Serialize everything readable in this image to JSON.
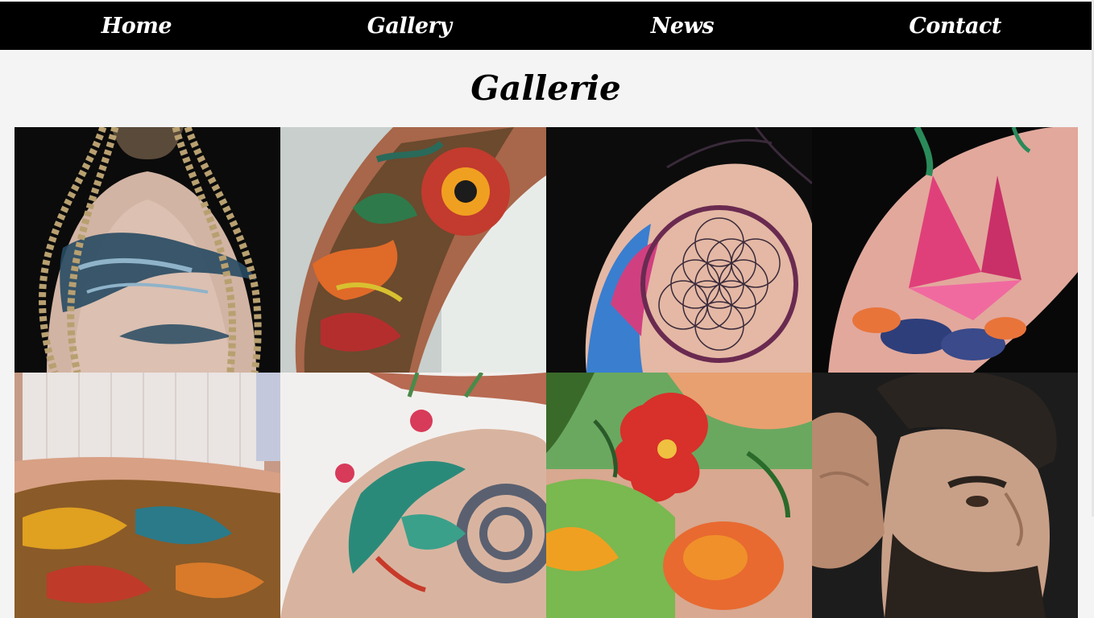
{
  "nav": {
    "items": [
      {
        "label": "Home"
      },
      {
        "label": "Gallery"
      },
      {
        "label": "News"
      },
      {
        "label": "Contact"
      }
    ]
  },
  "page": {
    "title": "Gallerie"
  },
  "colors": {
    "nav_bg": "#000000",
    "nav_text": "#ffffff",
    "page_bg": "#f4f4f4",
    "title": "#000000"
  },
  "gallery": {
    "images": [
      {
        "icon": "tattoo-photo-back-tribal"
      },
      {
        "icon": "tattoo-photo-arm-dragon"
      },
      {
        "icon": "tattoo-photo-shoulder-geometric"
      },
      {
        "icon": "tattoo-photo-arm-origami-crane"
      },
      {
        "icon": "tattoo-photo-sleeve"
      },
      {
        "icon": "tattoo-photo-shoulder-dragon"
      },
      {
        "icon": "tattoo-photo-hibiscus"
      },
      {
        "icon": "tattoo-photo-bearded-man"
      }
    ]
  }
}
